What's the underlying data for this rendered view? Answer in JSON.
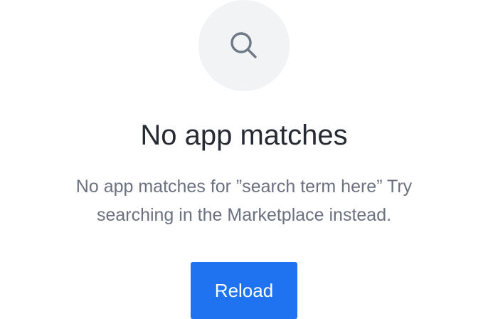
{
  "empty_state": {
    "icon": "search-icon",
    "title": "No app matches",
    "description": "No app matches for ”search term here” Try searching in the Marketplace instead.",
    "reload_label": "Reload"
  },
  "colors": {
    "icon_circle_bg": "#f2f3f5",
    "icon_stroke": "#6f7885",
    "title_text": "#262b33",
    "description_text": "#6b7180",
    "button_bg": "#1f73f1",
    "button_text": "#ffffff"
  }
}
